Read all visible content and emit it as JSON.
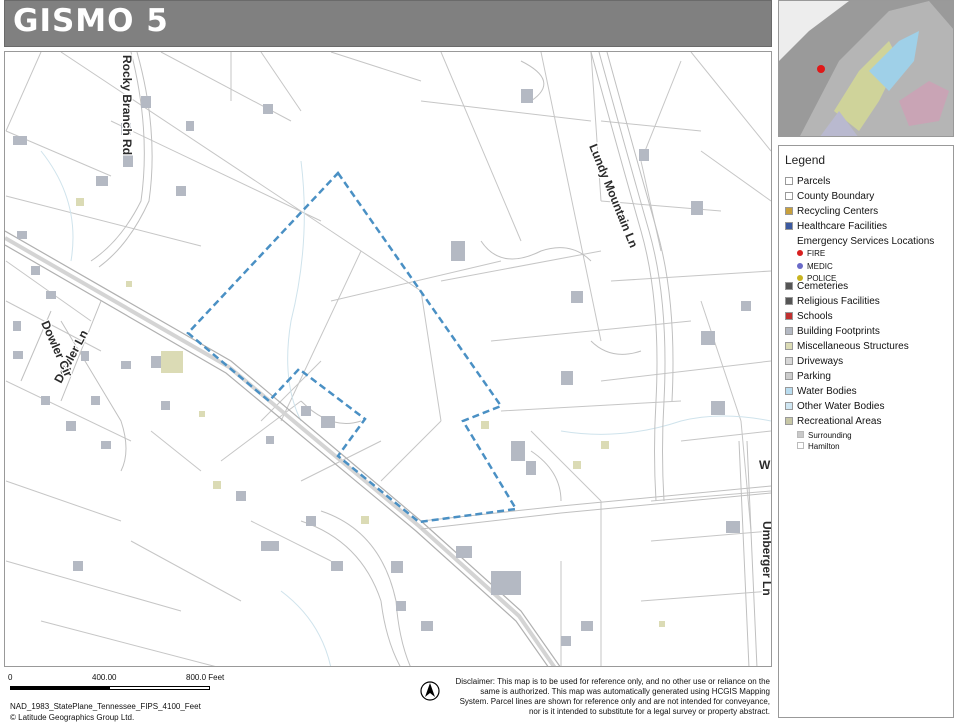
{
  "title": "GISMO 5",
  "map": {
    "road_labels": [
      {
        "text": "Rocky Branch Rd"
      },
      {
        "text": "Lundy Mountain Ln"
      },
      {
        "text": "Dowler Ln"
      },
      {
        "text": "Dowler Cir"
      },
      {
        "text": "Umberger Ln"
      },
      {
        "text": "W"
      }
    ],
    "colors": {
      "parcel_line": "#c6c6c6",
      "building": "#b4b9c3",
      "misc_structure": "#dbdbb5",
      "driveway": "#d7d7d7",
      "selection_outline": "#4a90c4",
      "water_line": "#cfe3ec"
    }
  },
  "overview": {
    "colors": {
      "land": "#8f8f8f",
      "water": "#9fd0e8",
      "recreation": "#cfd39a",
      "location_dot": "#e01818"
    }
  },
  "legend": {
    "title": "Legend",
    "items": [
      {
        "label": "Parcels",
        "swatch": "#ffffff"
      },
      {
        "label": "County Boundary",
        "swatch": "#ffffff"
      },
      {
        "label": "Recycling Centers",
        "swatch": "#c8a03c"
      },
      {
        "label": "Healthcare Facilities",
        "swatch": "#3c5aa0"
      },
      {
        "label": "Emergency Services Locations",
        "swatch": ""
      },
      {
        "label": "Cemeteries",
        "swatch": "#555555"
      },
      {
        "label": "Religious Facilities",
        "swatch": "#555555"
      },
      {
        "label": "Schools",
        "swatch": "#c03030"
      },
      {
        "label": "Building Footprints",
        "swatch": "#b4b9c3"
      },
      {
        "label": "Miscellaneous Structures",
        "swatch": "#dbdbb5"
      },
      {
        "label": "Driveways",
        "swatch": "#d7d7d7"
      },
      {
        "label": "Parking",
        "swatch": "#cccccc"
      },
      {
        "label": "Water Bodies",
        "swatch": "#b9dcef"
      },
      {
        "label": "Other Water Bodies",
        "swatch": "#cfe6f2"
      },
      {
        "label": "Recreational Areas",
        "swatch": "#c7c7a6"
      }
    ],
    "emergency_sub": [
      {
        "label": "FIRE",
        "color": "#d82020"
      },
      {
        "label": "MEDIC",
        "color": "#6a6ac8"
      },
      {
        "label": "POLICE",
        "color": "#c8b420"
      }
    ],
    "recreation_sub": [
      {
        "label": "Surrounding",
        "color": "#c9c9c9"
      },
      {
        "label": "Hamilton",
        "color": "#ffffff"
      }
    ]
  },
  "scale": {
    "labels": [
      "0",
      "400.00",
      "800.0 Feet"
    ]
  },
  "projection": "NAD_1983_StatePlane_Tennessee_FIPS_4100_Feet",
  "copyright": "© Latitude Geographics Group Ltd.",
  "disclaimer": "Disclaimer: This map is to be used for reference only, and no other use or reliance on the same is authorized. This map was automatically generated using HCGIS Mapping System. Parcel lines are shown for reference only and are not intended for conveyance, nor is it intended to substitute for a legal survey or property abstract."
}
